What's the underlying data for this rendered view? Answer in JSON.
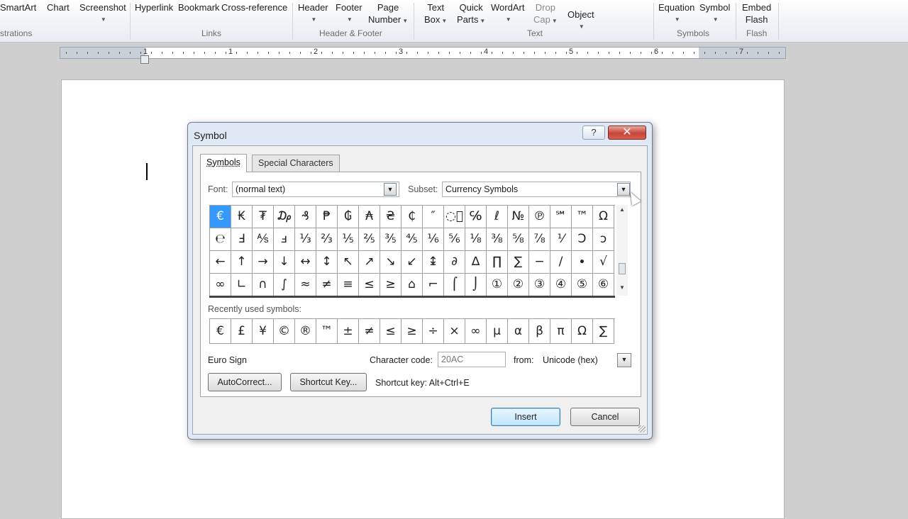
{
  "ribbon": {
    "buttons": [
      {
        "name": "smartart-button",
        "line1": "SmartArt",
        "line2": "",
        "caret": false,
        "dim": false
      },
      {
        "name": "chart-button",
        "line1": "Chart",
        "line2": "",
        "caret": false,
        "dim": false
      },
      {
        "name": "screenshot-button",
        "line1": "Screenshot",
        "line2": "",
        "caret": true,
        "dim": false
      },
      {
        "name": "hyperlink-button",
        "line1": "Hyperlink",
        "line2": "",
        "caret": false,
        "dim": false
      },
      {
        "name": "bookmark-button",
        "line1": "Bookmark",
        "line2": "",
        "caret": false,
        "dim": false
      },
      {
        "name": "cross-reference-button",
        "line1": "Cross-reference",
        "line2": "",
        "caret": false,
        "dim": false
      },
      {
        "name": "header-button",
        "line1": "Header",
        "line2": "",
        "caret": true,
        "dim": false
      },
      {
        "name": "footer-button",
        "line1": "Footer",
        "line2": "",
        "caret": true,
        "dim": false
      },
      {
        "name": "page-number-button",
        "line1": "Page",
        "line2": "Number",
        "caret": true,
        "dim": false
      },
      {
        "name": "text-box-button",
        "line1": "Text",
        "line2": "Box",
        "caret": true,
        "dim": false
      },
      {
        "name": "quick-parts-button",
        "line1": "Quick",
        "line2": "Parts",
        "caret": true,
        "dim": false
      },
      {
        "name": "wordart-button",
        "line1": "WordArt",
        "line2": "",
        "caret": true,
        "dim": false
      },
      {
        "name": "drop-cap-button",
        "line1": "Drop",
        "line2": "Cap",
        "caret": true,
        "dim": true
      },
      {
        "name": "object-button",
        "line1": "Object",
        "line2": "",
        "caret": true,
        "dim": false
      },
      {
        "name": "equation-button",
        "line1": "Equation",
        "line2": "",
        "caret": true,
        "dim": false
      },
      {
        "name": "symbol-button",
        "line1": "Symbol",
        "line2": "",
        "caret": true,
        "dim": false
      },
      {
        "name": "embed-flash-button",
        "line1": "Embed",
        "line2": "Flash",
        "caret": false,
        "dim": false
      }
    ],
    "groups": [
      "strations",
      "Links",
      "Header & Footer",
      "Text",
      "Symbols",
      "Flash"
    ]
  },
  "ruler": {
    "numbers": [
      "1",
      "1",
      "2",
      "3",
      "4",
      "5",
      "6",
      "7"
    ]
  },
  "dialog": {
    "title": "Symbol",
    "help": "?",
    "close": "✕",
    "tabs": [
      "Symbols",
      "Special Characters"
    ],
    "font_label": "Font:",
    "font_value": "(normal text)",
    "subset_label": "Subset:",
    "subset_value": "Currency Symbols",
    "symbols": [
      "€",
      "₭",
      "₮",
      "₯",
      "₰",
      "₱",
      "₲",
      "₳",
      "₴",
      "₵",
      "″",
      "◌⃝",
      "℅",
      "ℓ",
      "№",
      "℗",
      "℠",
      "™",
      "Ω",
      "℮",
      "Ⅎ",
      "⅍",
      "ⅎ",
      "⅓",
      "⅔",
      "⅕",
      "⅖",
      "⅗",
      "⅘",
      "⅙",
      "⅚",
      "⅛",
      "⅜",
      "⅝",
      "⅞",
      "⅟",
      "Ↄ",
      "ↄ",
      "←",
      "↑",
      "→",
      "↓",
      "↔",
      "↕",
      "↖",
      "↗",
      "↘",
      "↙",
      "↨",
      "∂",
      "∆",
      "∏",
      "∑",
      "−",
      "∕",
      "∙",
      "√",
      "∞",
      "∟",
      "∩",
      "∫",
      "≈",
      "≠",
      "≡",
      "≤",
      "≥",
      "⌂",
      "⌐",
      "⌠",
      "⌡",
      "①",
      "②",
      "③",
      "④",
      "⑤",
      "⑥"
    ],
    "recently_used_label": "Recently used symbols:",
    "recent": [
      "€",
      "£",
      "¥",
      "©",
      "®",
      "™",
      "±",
      "≠",
      "≤",
      "≥",
      "÷",
      "×",
      "∞",
      "µ",
      "α",
      "β",
      "π",
      "Ω",
      "∑"
    ],
    "char_name": "Euro Sign",
    "char_code_label": "Character code:",
    "char_code": "20AC",
    "from_label": "from:",
    "from_value": "Unicode (hex)",
    "autocorrect": "AutoCorrect...",
    "shortcut_key_button": "Shortcut Key...",
    "shortcut_key_text": "Shortcut key: Alt+Ctrl+E",
    "insert": "Insert",
    "cancel": "Cancel",
    "dropdown_arrow": "▼",
    "scroll_up": "▲",
    "scroll_down": "▼"
  }
}
